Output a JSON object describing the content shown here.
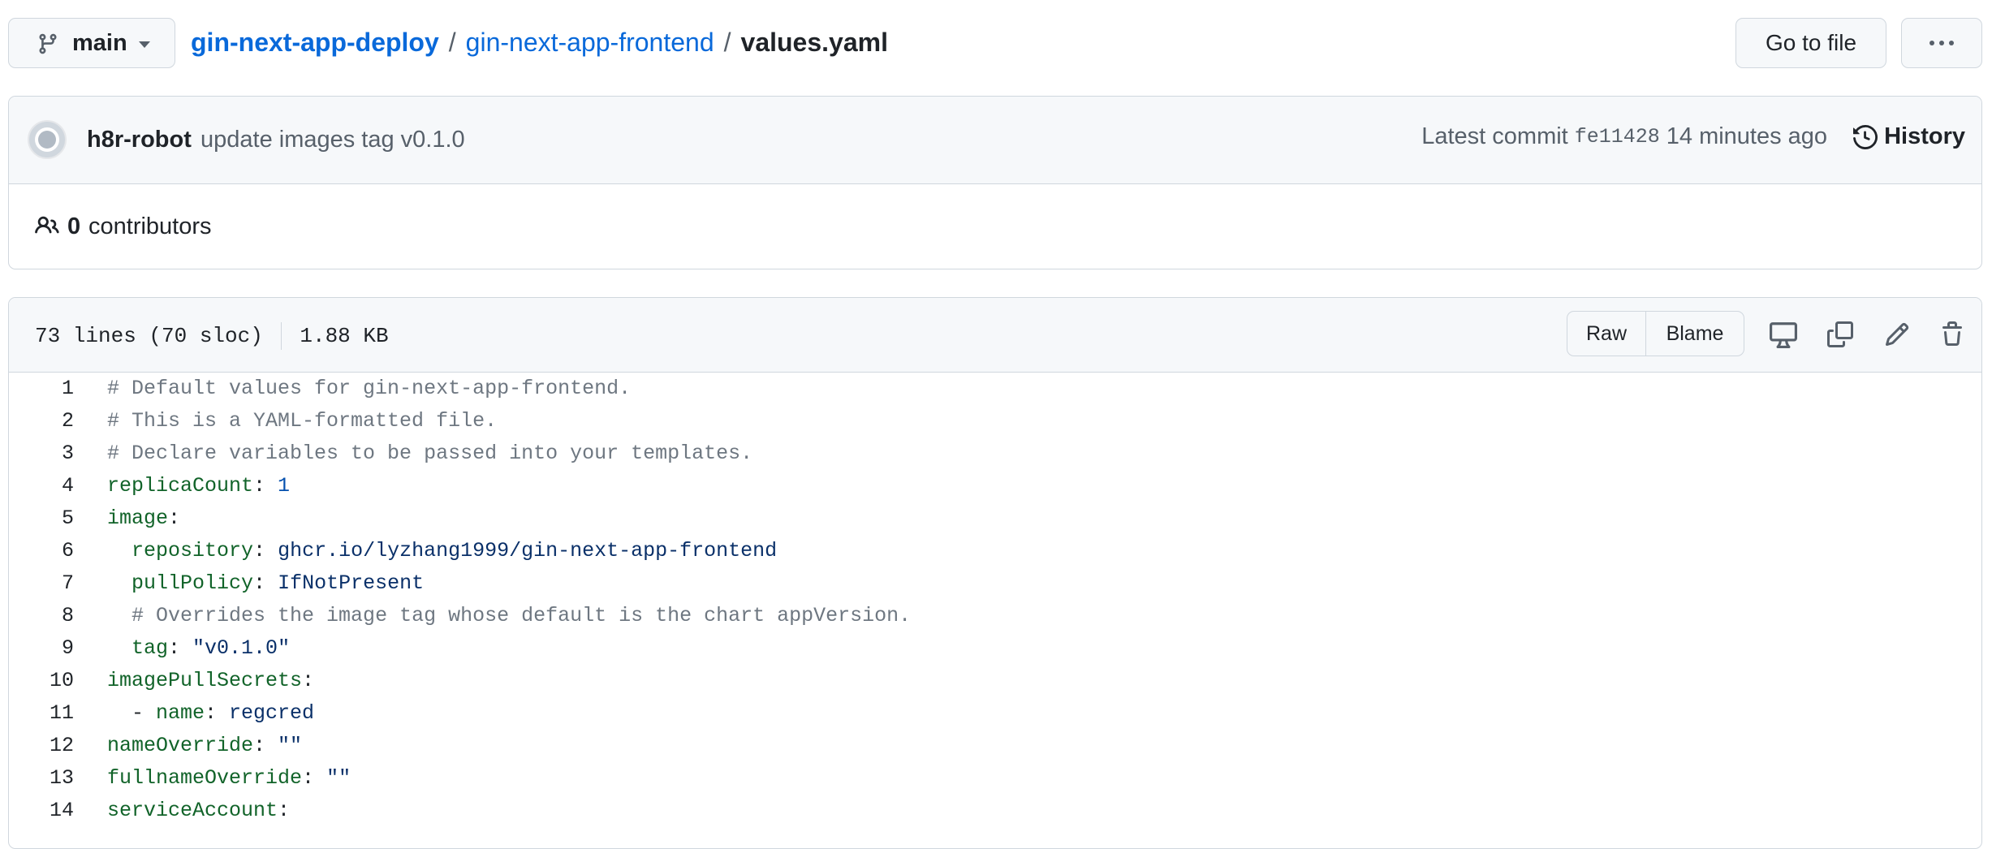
{
  "branch": {
    "label": "main"
  },
  "breadcrumb": {
    "repo": "gin-next-app-deploy",
    "dir": "gin-next-app-frontend",
    "file": "values.yaml",
    "separator": "/"
  },
  "actions": {
    "go_to_file": "Go to file",
    "more": "···"
  },
  "commit": {
    "author": "h8r-robot",
    "message": "update images tag v0.1.0",
    "latest_label": "Latest commit",
    "sha": "fe11428",
    "time_ago": "14 minutes ago",
    "history_label": "History"
  },
  "contributors": {
    "count": "0",
    "label": "contributors"
  },
  "file": {
    "lines_info": "73 lines (70 sloc)",
    "size": "1.88 KB",
    "raw_label": "Raw",
    "blame_label": "Blame"
  },
  "icons": {
    "branch": "git-branch-icon",
    "caret": "triangle-down-icon",
    "kebab": "kebab-horizontal-icon",
    "history": "history-icon",
    "people": "people-icon",
    "display": "device-desktop-icon",
    "copy": "copy-icon",
    "edit": "pencil-icon",
    "delete": "trash-icon"
  },
  "colors": {
    "link": "#0969da",
    "comment": "#6e7781",
    "key": "#116329",
    "number": "#0550ae",
    "string": "#0a3069",
    "border": "#d0d7de",
    "header_bg": "#f6f8fa"
  },
  "code_lines": [
    {
      "n": "1",
      "tokens": [
        {
          "t": "# Default values for gin-next-app-frontend.",
          "c": "comment"
        }
      ]
    },
    {
      "n": "2",
      "tokens": [
        {
          "t": "# This is a YAML-formatted file.",
          "c": "comment"
        }
      ]
    },
    {
      "n": "3",
      "tokens": [
        {
          "t": "# Declare variables to be passed into your templates.",
          "c": "comment"
        }
      ]
    },
    {
      "n": "4",
      "tokens": [
        {
          "t": "replicaCount",
          "c": "key"
        },
        {
          "t": ": ",
          "c": "punct"
        },
        {
          "t": "1",
          "c": "num"
        }
      ]
    },
    {
      "n": "5",
      "tokens": [
        {
          "t": "image",
          "c": "key"
        },
        {
          "t": ":",
          "c": "punct"
        }
      ]
    },
    {
      "n": "6",
      "tokens": [
        {
          "t": "  ",
          "c": "punct"
        },
        {
          "t": "repository",
          "c": "key"
        },
        {
          "t": ": ",
          "c": "punct"
        },
        {
          "t": "ghcr.io/lyzhang1999/gin-next-app-frontend",
          "c": "str"
        }
      ]
    },
    {
      "n": "7",
      "tokens": [
        {
          "t": "  ",
          "c": "punct"
        },
        {
          "t": "pullPolicy",
          "c": "key"
        },
        {
          "t": ": ",
          "c": "punct"
        },
        {
          "t": "IfNotPresent",
          "c": "str"
        }
      ]
    },
    {
      "n": "8",
      "tokens": [
        {
          "t": "  ",
          "c": "punct"
        },
        {
          "t": "# Overrides the image tag whose default is the chart appVersion.",
          "c": "comment"
        }
      ]
    },
    {
      "n": "9",
      "tokens": [
        {
          "t": "  ",
          "c": "punct"
        },
        {
          "t": "tag",
          "c": "key"
        },
        {
          "t": ": ",
          "c": "punct"
        },
        {
          "t": "\"v0.1.0\"",
          "c": "str"
        }
      ]
    },
    {
      "n": "10",
      "tokens": [
        {
          "t": "imagePullSecrets",
          "c": "key"
        },
        {
          "t": ":",
          "c": "punct"
        }
      ]
    },
    {
      "n": "11",
      "tokens": [
        {
          "t": "  - ",
          "c": "punct"
        },
        {
          "t": "name",
          "c": "key"
        },
        {
          "t": ": ",
          "c": "punct"
        },
        {
          "t": "regcred",
          "c": "str"
        }
      ]
    },
    {
      "n": "12",
      "tokens": [
        {
          "t": "nameOverride",
          "c": "key"
        },
        {
          "t": ": ",
          "c": "punct"
        },
        {
          "t": "\"\"",
          "c": "str"
        }
      ]
    },
    {
      "n": "13",
      "tokens": [
        {
          "t": "fullnameOverride",
          "c": "key"
        },
        {
          "t": ": ",
          "c": "punct"
        },
        {
          "t": "\"\"",
          "c": "str"
        }
      ]
    },
    {
      "n": "14",
      "tokens": [
        {
          "t": "serviceAccount",
          "c": "key"
        },
        {
          "t": ":",
          "c": "punct"
        }
      ]
    }
  ]
}
